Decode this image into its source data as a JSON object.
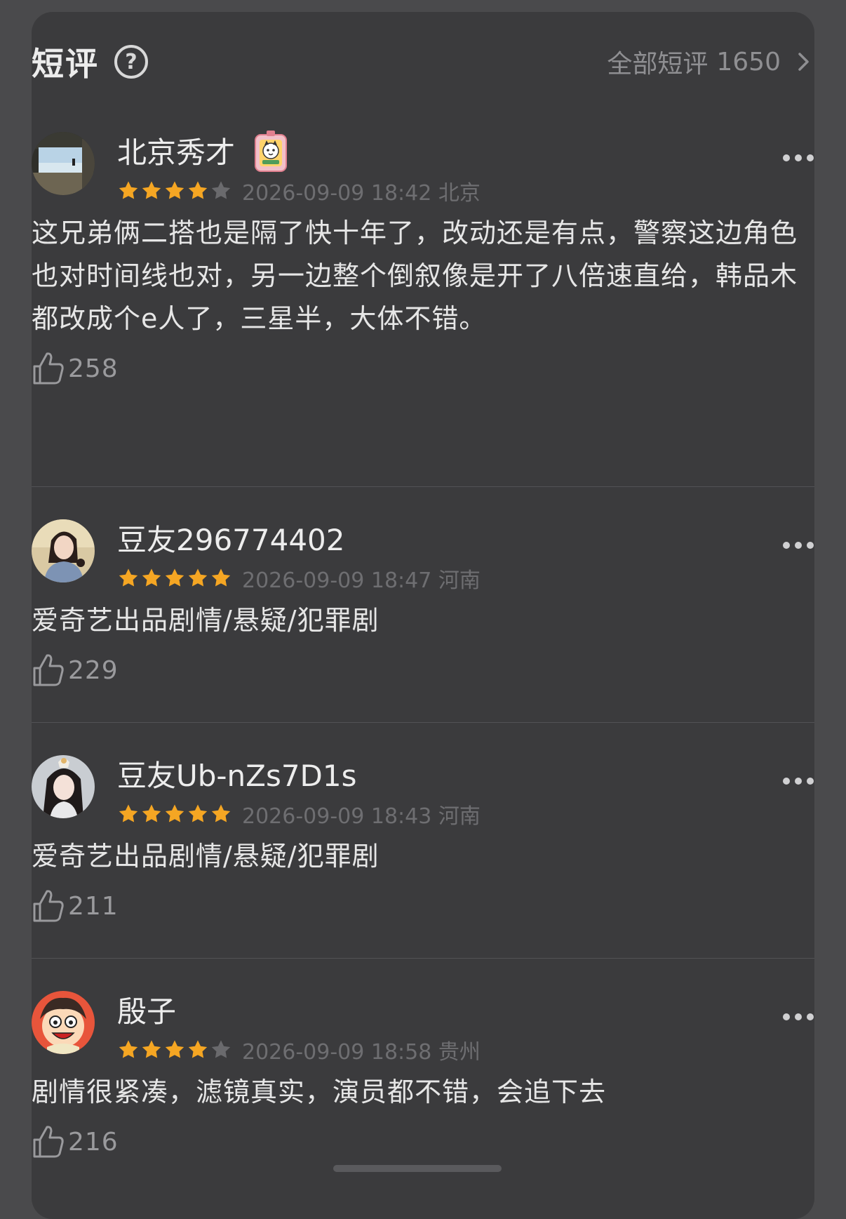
{
  "header": {
    "title": "短评",
    "help_icon": "question-circle-icon",
    "all_reviews_label": "全部短评",
    "all_reviews_count": "1650",
    "chevron_icon": "chevron-right-icon"
  },
  "colors": {
    "background": "#3b3b3d",
    "star_filled": "#f5a623",
    "star_empty": "#6a6a6d",
    "text_primary": "#ececec",
    "text_secondary": "#6e6e71"
  },
  "reviews": [
    {
      "username": "北京秀才",
      "has_badge": true,
      "badge_icon": "tiger-badge-icon",
      "rating": 4,
      "rating_max": 5,
      "meta": "2026-09-09 18:42 北京",
      "text": "这兄弟俩二搭也是隔了快十年了，改动还是有点，警察这边角色也对时间线也对，另一边整个倒叙像是开了八倍速直给，韩品木都改成个e人了，三星半，大体不错。",
      "likes": "258"
    },
    {
      "username": "豆友296774402",
      "has_badge": false,
      "rating": 5,
      "rating_max": 5,
      "meta": "2026-09-09 18:47 河南",
      "text": "爱奇艺出品剧情/悬疑/犯罪剧",
      "likes": "229"
    },
    {
      "username": "豆友Ub-nZs7D1s",
      "has_badge": false,
      "rating": 5,
      "rating_max": 5,
      "meta": "2026-09-09 18:43 河南",
      "text": "爱奇艺出品剧情/悬疑/犯罪剧",
      "likes": "211"
    },
    {
      "username": "殷子",
      "has_badge": false,
      "rating": 4,
      "rating_max": 5,
      "meta": "2026-09-09 18:58 贵州",
      "text": "剧情很紧凑，滤镜真实，演员都不错，会追下去",
      "likes": "216"
    }
  ]
}
